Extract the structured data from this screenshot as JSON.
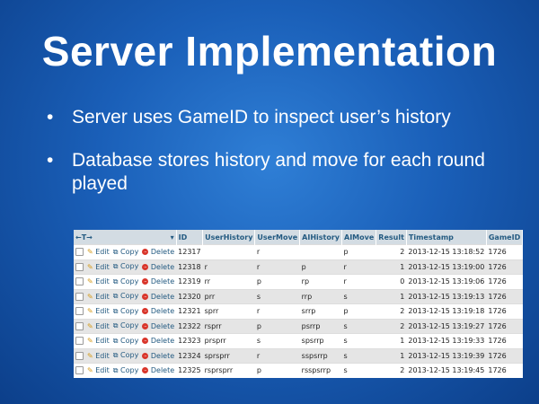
{
  "slide": {
    "title": "Server Implementation",
    "bullets": [
      "Server uses GameID to inspect user’s history",
      "Database stores history and move for each round played"
    ]
  },
  "table": {
    "headers": [
      "ID",
      "UserHistory",
      "UserMove",
      "AIHistory",
      "AIMove",
      "Result",
      "Timestamp",
      "GameID"
    ],
    "action_labels": {
      "edit": "Edit",
      "copy": "Copy",
      "delete": "Delete"
    },
    "rows": [
      [
        "12317",
        "",
        "r",
        "",
        "p",
        "2",
        "2013-12-15 13:18:52",
        "1726"
      ],
      [
        "12318",
        "r",
        "r",
        "p",
        "r",
        "1",
        "2013-12-15 13:19:00",
        "1726"
      ],
      [
        "12319",
        "rr",
        "p",
        "rp",
        "r",
        "0",
        "2013-12-15 13:19:06",
        "1726"
      ],
      [
        "12320",
        "prr",
        "s",
        "rrp",
        "s",
        "1",
        "2013-12-15 13:19:13",
        "1726"
      ],
      [
        "12321",
        "sprr",
        "r",
        "srrp",
        "p",
        "2",
        "2013-12-15 13:19:18",
        "1726"
      ],
      [
        "12322",
        "rsprr",
        "p",
        "psrrp",
        "s",
        "2",
        "2013-12-15 13:19:27",
        "1726"
      ],
      [
        "12323",
        "prsprr",
        "s",
        "spsrrp",
        "s",
        "1",
        "2013-12-15 13:19:33",
        "1726"
      ],
      [
        "12324",
        "sprsprr",
        "r",
        "sspsrrp",
        "s",
        "1",
        "2013-12-15 13:19:39",
        "1726"
      ],
      [
        "12325",
        "rsprsprr",
        "p",
        "rsspsrrp",
        "s",
        "2",
        "2013-12-15 13:19:45",
        "1726"
      ]
    ]
  }
}
